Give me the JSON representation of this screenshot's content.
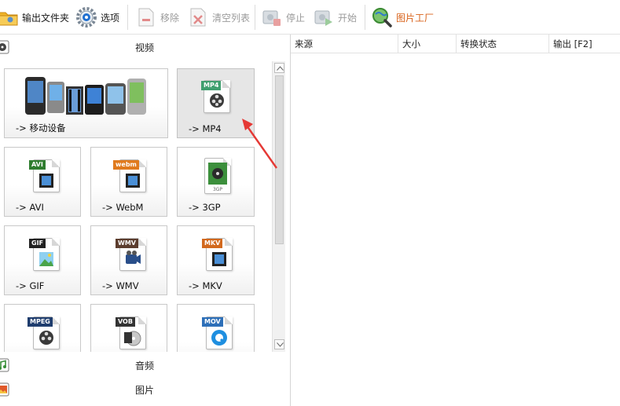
{
  "toolbar": {
    "output_folder": "输出文件夹",
    "options": "选项",
    "remove": "移除",
    "clear_list": "清空列表",
    "stop": "停止",
    "start": "开始",
    "picture_factory": "图片工厂"
  },
  "left_pane": {
    "video_category": "视频",
    "audio_category": "音频",
    "image_category": "图片",
    "tiles": [
      {
        "label": "-> 移动设备"
      },
      {
        "label": "-> MP4",
        "badge": "MP4"
      },
      {
        "label": "-> AVI",
        "badge": "AVI"
      },
      {
        "label": "-> WebM",
        "badge": "webm"
      },
      {
        "label": "-> 3GP",
        "badge": "3GP"
      },
      {
        "label": "-> GIF",
        "badge": "GIF"
      },
      {
        "label": "-> WMV",
        "badge": "WMV"
      },
      {
        "label": "-> MKV",
        "badge": "MKV"
      },
      {
        "label": "",
        "badge": "MPEG"
      },
      {
        "label": "",
        "badge": "VOB"
      },
      {
        "label": "",
        "badge": "MOV"
      }
    ]
  },
  "file_list": {
    "columns": [
      "来源",
      "大小",
      "转换状态",
      "输出 [F2]"
    ]
  },
  "colors": {
    "accent": "#d9621a",
    "selected_tile": "#e6e6e6",
    "annotation_arrow": "#e53935"
  }
}
